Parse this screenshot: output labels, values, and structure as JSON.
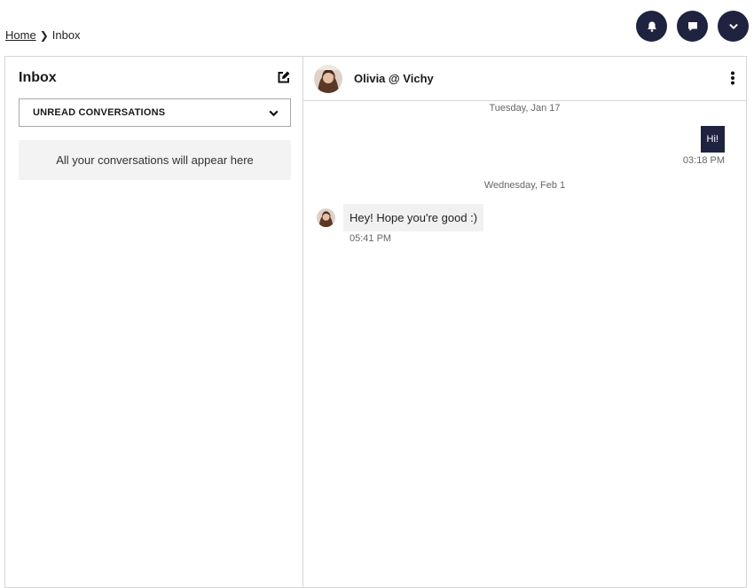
{
  "breadcrumb": {
    "home": "Home",
    "current": "Inbox"
  },
  "top_actions": [
    {
      "icon": "bell-icon"
    },
    {
      "icon": "chat-bubble-icon"
    },
    {
      "icon": "chevron-down-icon"
    }
  ],
  "inbox": {
    "title": "Inbox",
    "filter": "UNREAD CONVERSATIONS",
    "empty_message": "All your conversations will appear here"
  },
  "conversation": {
    "contact_name": "Olivia @ Vichy",
    "messages": [
      {
        "date": "Tuesday, Jan 17",
        "direction": "outgoing",
        "text": "Hi!",
        "time": "03:18 PM"
      },
      {
        "date": "Wednesday, Feb 1",
        "direction": "incoming",
        "text": "Hey! Hope you're good :)",
        "time": "05:41 PM"
      }
    ]
  },
  "colors": {
    "navy": "#1f2340",
    "border": "#d6d6d6",
    "muted_bg": "#f3f3f3"
  }
}
